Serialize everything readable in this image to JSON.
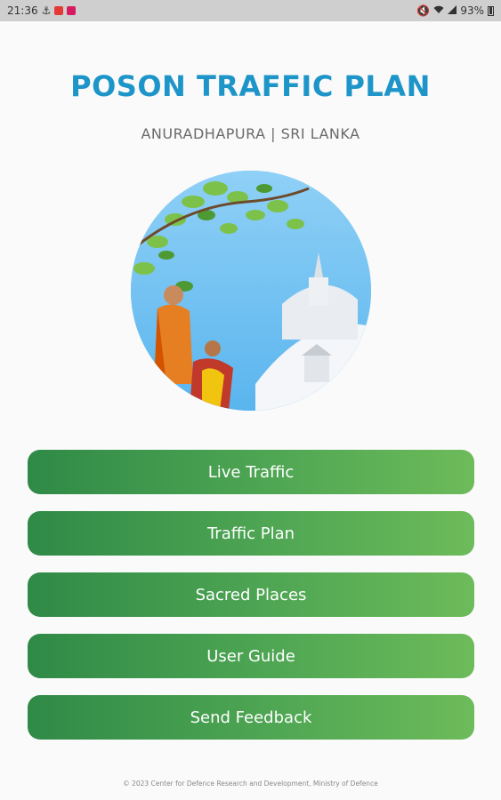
{
  "status_bar": {
    "time": "21:36",
    "battery_text": "93%",
    "icons": [
      "usb-icon",
      "app-notification-icon",
      "app-notification-icon",
      "mute-icon",
      "wifi-icon",
      "signal-icon",
      "battery-icon"
    ]
  },
  "header": {
    "title": "POSON TRAFFIC PLAN",
    "subtitle": "ANURADHAPURA | SRI LANKA"
  },
  "menu": {
    "live_traffic": "Live Traffic",
    "traffic_plan": "Traffic Plan",
    "sacred_places": "Sacred Places",
    "user_guide": "User Guide",
    "send_feedback": "Send Feedback"
  },
  "footer": {
    "copyright": "© 2023 Center for Defence Research and Development, Ministry of Defence"
  },
  "colors": {
    "title": "#1e95c8",
    "button_start": "#2f8a47",
    "button_end": "#6dbb5a"
  }
}
